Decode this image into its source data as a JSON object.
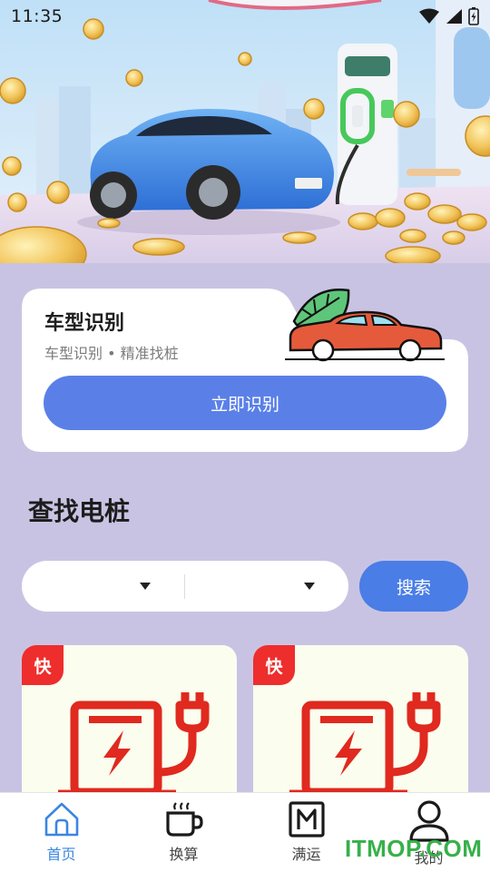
{
  "status_bar": {
    "time": "11:35"
  },
  "recognition": {
    "title": "车型识别",
    "subtitle": "车型识别 • 精准找桩",
    "button_label": "立即识别"
  },
  "station_search": {
    "title": "查找电桩",
    "dropdown_1": {
      "value": ""
    },
    "dropdown_2": {
      "value": ""
    },
    "search_label": "搜索"
  },
  "stations": [
    {
      "badge": "快"
    },
    {
      "badge": "快"
    }
  ],
  "tab_bar": {
    "items": [
      {
        "label": "首页",
        "icon": "home-icon",
        "active": true
      },
      {
        "label": "换算",
        "icon": "coffee-cup-icon",
        "active": false
      },
      {
        "label": "满运",
        "icon": "m-box-icon",
        "active": false
      },
      {
        "label": "我的",
        "icon": "user-icon",
        "active": false
      }
    ]
  },
  "watermark": "ITMOP.COM",
  "colors": {
    "background": "#c9c3e3",
    "primary_button": "#5a80e8",
    "search_button": "#4a7de6",
    "badge": "#ee2d2d",
    "active_tab": "#3a86e0",
    "charger_red": "#e0291f"
  }
}
